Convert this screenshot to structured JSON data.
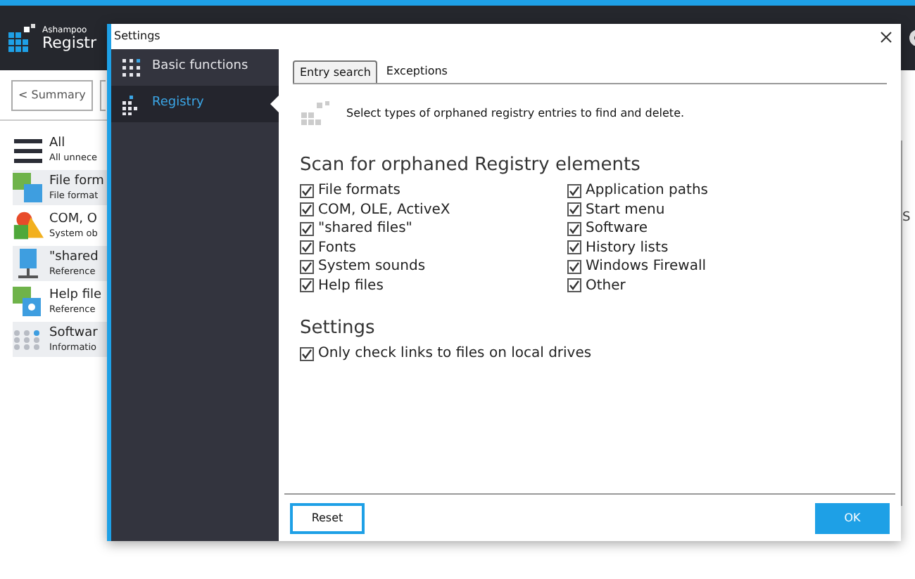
{
  "app": {
    "brand": "Ashampoo",
    "title": "Registr",
    "back_button": "< Summary",
    "categories": [
      {
        "kind": "menu",
        "title": "All",
        "subtitle": "All unnece",
        "selected": false
      },
      {
        "kind": "files",
        "title": "File form",
        "subtitle": "File format",
        "selected": true
      },
      {
        "kind": "com",
        "title": "COM, O",
        "subtitle": "System ob",
        "selected": false
      },
      {
        "kind": "shared",
        "title": "\"shared",
        "subtitle": "Reference",
        "selected": true
      },
      {
        "kind": "help",
        "title": "Help file",
        "subtitle": "Reference",
        "selected": false
      },
      {
        "kind": "software",
        "title": "Softwar",
        "subtitle": "Informatio",
        "selected": true
      }
    ],
    "right_edge_text": "S"
  },
  "dialog": {
    "title": "Settings",
    "sidebar": [
      {
        "kind": "basic",
        "label": "Basic functions",
        "selected": false
      },
      {
        "kind": "registry",
        "label": "Registry",
        "selected": true
      }
    ],
    "tabs": [
      {
        "label": "Entry search",
        "selected": true
      },
      {
        "label": "Exceptions",
        "selected": false
      }
    ],
    "intro": "Select types of orphaned registry entries to find and delete.",
    "scan_heading": "Scan for orphaned Registry elements",
    "scan_left": [
      {
        "label": "File formats",
        "checked": true
      },
      {
        "label": "COM, OLE, ActiveX",
        "checked": true
      },
      {
        "label": "\"shared files\"",
        "checked": true
      },
      {
        "label": "Fonts",
        "checked": true
      },
      {
        "label": "System sounds",
        "checked": true
      },
      {
        "label": "Help files",
        "checked": true
      }
    ],
    "scan_right": [
      {
        "label": "Application paths",
        "checked": true
      },
      {
        "label": "Start menu",
        "checked": true
      },
      {
        "label": "Software",
        "checked": true
      },
      {
        "label": "History lists",
        "checked": true
      },
      {
        "label": "Windows Firewall",
        "checked": true
      },
      {
        "label": "Other",
        "checked": true
      }
    ],
    "settings_heading": "Settings",
    "settings": [
      {
        "label": "Only check links to files on local drives",
        "checked": true
      }
    ],
    "buttons": {
      "reset": "Reset",
      "ok": "OK"
    }
  }
}
